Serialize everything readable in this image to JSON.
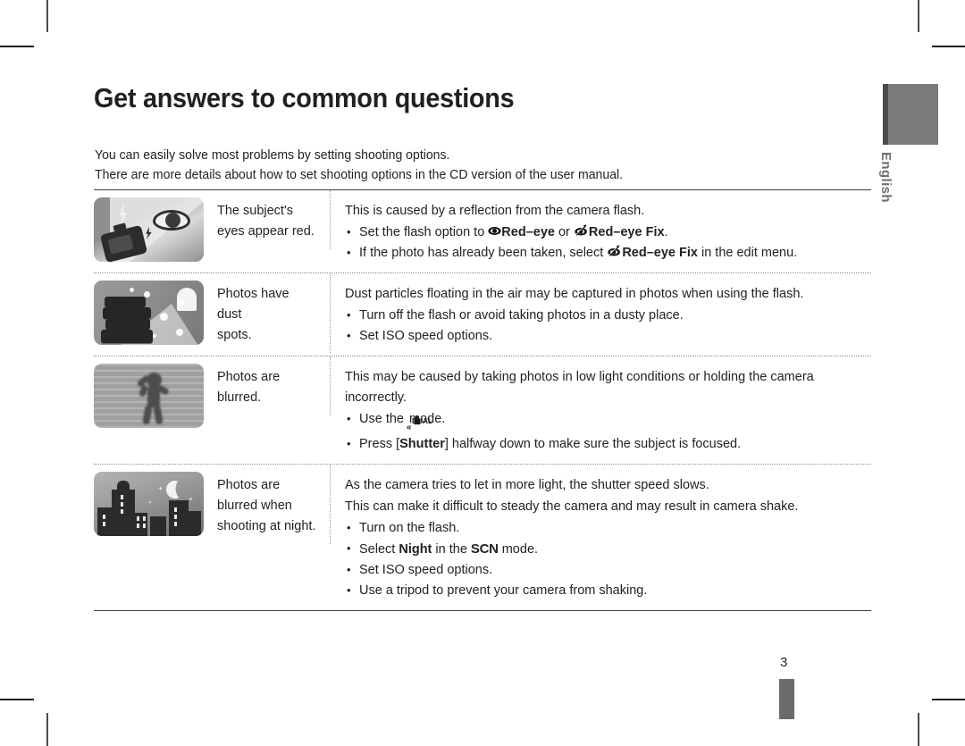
{
  "document": {
    "title": "Get answers to common questions",
    "intro_line_1": "You can easily solve most problems by setting shooting options.",
    "intro_line_2": "There are more details about how to set shooting options in the CD version of the user manual.",
    "page_number": "3",
    "language_tab": "English"
  },
  "colors": {
    "text": "#231f20",
    "tab_gray": "#7b7b7b",
    "tab_edge": "#4a4a4a",
    "rule": "#3b3b3b",
    "dotted_rule": "#8d8d8d",
    "footer_bar": "#6b6b6b"
  },
  "table": {
    "rows": [
      {
        "image_name": "red-eye-flash-illustration",
        "question": "The subject's eyes appear red.",
        "lead": "This is caused by a reflection from the camera flash.",
        "bullets": [
          {
            "segments": [
              {
                "type": "text",
                "value": "Set the flash option to "
              },
              {
                "type": "icon",
                "icon": "red-eye-icon"
              },
              {
                "type": "bold",
                "value": "Red–eye"
              },
              {
                "type": "text",
                "value": " or "
              },
              {
                "type": "icon",
                "icon": "red-eye-fix-icon"
              },
              {
                "type": "bold",
                "value": "Red–eye Fix"
              },
              {
                "type": "text",
                "value": "."
              }
            ]
          },
          {
            "segments": [
              {
                "type": "text",
                "value": "If the photo has already been taken, select "
              },
              {
                "type": "icon",
                "icon": "red-eye-fix-icon"
              },
              {
                "type": "bold",
                "value": "Red–eye Fix"
              },
              {
                "type": "text",
                "value": " in the edit menu."
              }
            ]
          }
        ]
      },
      {
        "image_name": "dust-spots-books-illustration",
        "question": "Photos have dust spots.",
        "question_lines": [
          "Photos have",
          "dust",
          "spots."
        ],
        "lead": "Dust particles floating in the air may be captured in photos when using the flash.",
        "bullets": [
          {
            "segments": [
              {
                "type": "text",
                "value": "Turn off the flash or avoid taking photos in a dusty place."
              }
            ]
          },
          {
            "segments": [
              {
                "type": "text",
                "value": "Set ISO speed options."
              }
            ]
          }
        ]
      },
      {
        "image_name": "blurred-person-illustration",
        "question": "Photos are blurred.",
        "question_lines": [
          "Photos are",
          "blurred."
        ],
        "lead": "This may be caused by taking photos in low light conditions or holding the camera incorrectly.",
        "bullets": [
          {
            "segments": [
              {
                "type": "text",
                "value": "Use the "
              },
              {
                "type": "icon",
                "icon": "dual-is-icon",
                "label": "DUAL"
              },
              {
                "type": "text",
                "value": " mode."
              }
            ]
          },
          {
            "segments": [
              {
                "type": "text",
                "value": "Press ["
              },
              {
                "type": "bold",
                "value": "Shutter"
              },
              {
                "type": "text",
                "value": "] halfway down to make sure the subject is focused."
              }
            ]
          }
        ]
      },
      {
        "image_name": "night-city-illustration",
        "question": "Photos are blurred when shooting at night.",
        "question_lines": [
          "Photos are",
          "blurred when",
          "shooting at night."
        ],
        "lead": "As the camera tries to let in more light, the shutter speed slows.",
        "lead2": "This can make it difficult to steady the camera and may result in camera shake.",
        "bullets": [
          {
            "segments": [
              {
                "type": "text",
                "value": "Turn on the flash."
              }
            ]
          },
          {
            "segments": [
              {
                "type": "text",
                "value": "Select "
              },
              {
                "type": "bold",
                "value": "Night"
              },
              {
                "type": "text",
                "value": " in the "
              },
              {
                "type": "scn",
                "value": "SCN"
              },
              {
                "type": "text",
                "value": " mode."
              }
            ]
          },
          {
            "segments": [
              {
                "type": "text",
                "value": "Set ISO speed options."
              }
            ]
          },
          {
            "segments": [
              {
                "type": "text",
                "value": "Use a tripod to prevent your camera from shaking."
              }
            ]
          }
        ]
      }
    ]
  }
}
